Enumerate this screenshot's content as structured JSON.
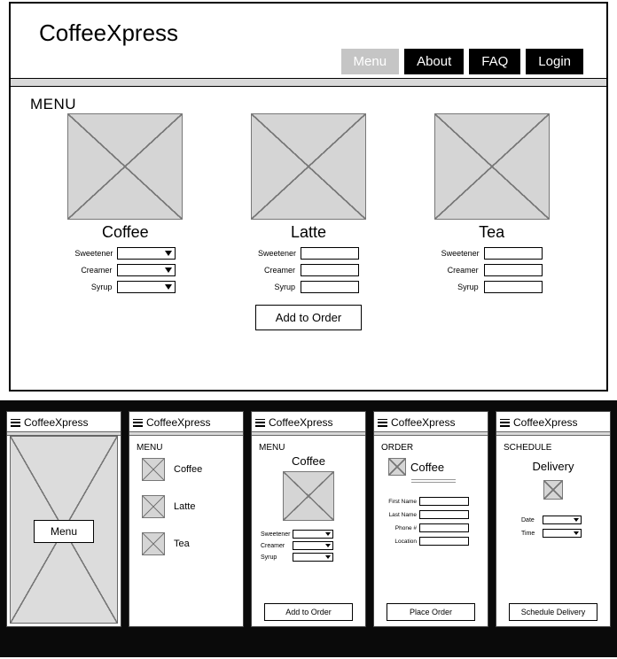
{
  "site": {
    "title": "CoffeeXpress"
  },
  "nav": {
    "items": [
      "Menu",
      "About",
      "FAQ",
      "Login"
    ]
  },
  "menu": {
    "section_title": "MENU",
    "products": [
      {
        "name": "Coffee",
        "options": [
          "Sweetener",
          "Creamer",
          "Syrup"
        ],
        "control": "dropdown"
      },
      {
        "name": "Latte",
        "options": [
          "Sweetener",
          "Creamer",
          "Syrup"
        ],
        "control": "text"
      },
      {
        "name": "Tea",
        "options": [
          "Sweetener",
          "Creamer",
          "Syrup"
        ],
        "control": "text"
      }
    ],
    "add_button": "Add to Order"
  },
  "mobile": {
    "m1": {
      "button": "Menu"
    },
    "m2": {
      "title": "MENU",
      "items": [
        "Coffee",
        "Latte",
        "Tea"
      ]
    },
    "m3": {
      "title": "MENU",
      "product": "Coffee",
      "options": [
        "Sweetener",
        "Creamer",
        "Syrup"
      ],
      "button": "Add to Order"
    },
    "m4": {
      "title": "ORDER",
      "product": "Coffee",
      "fields": [
        "First Name",
        "Last Name",
        "Phone #",
        "Location"
      ],
      "button": "Place Order"
    },
    "m5": {
      "title": "SCHEDULE",
      "subtitle": "Delivery",
      "fields": [
        "Date",
        "Time"
      ],
      "button": "Schedule Delivery"
    }
  }
}
